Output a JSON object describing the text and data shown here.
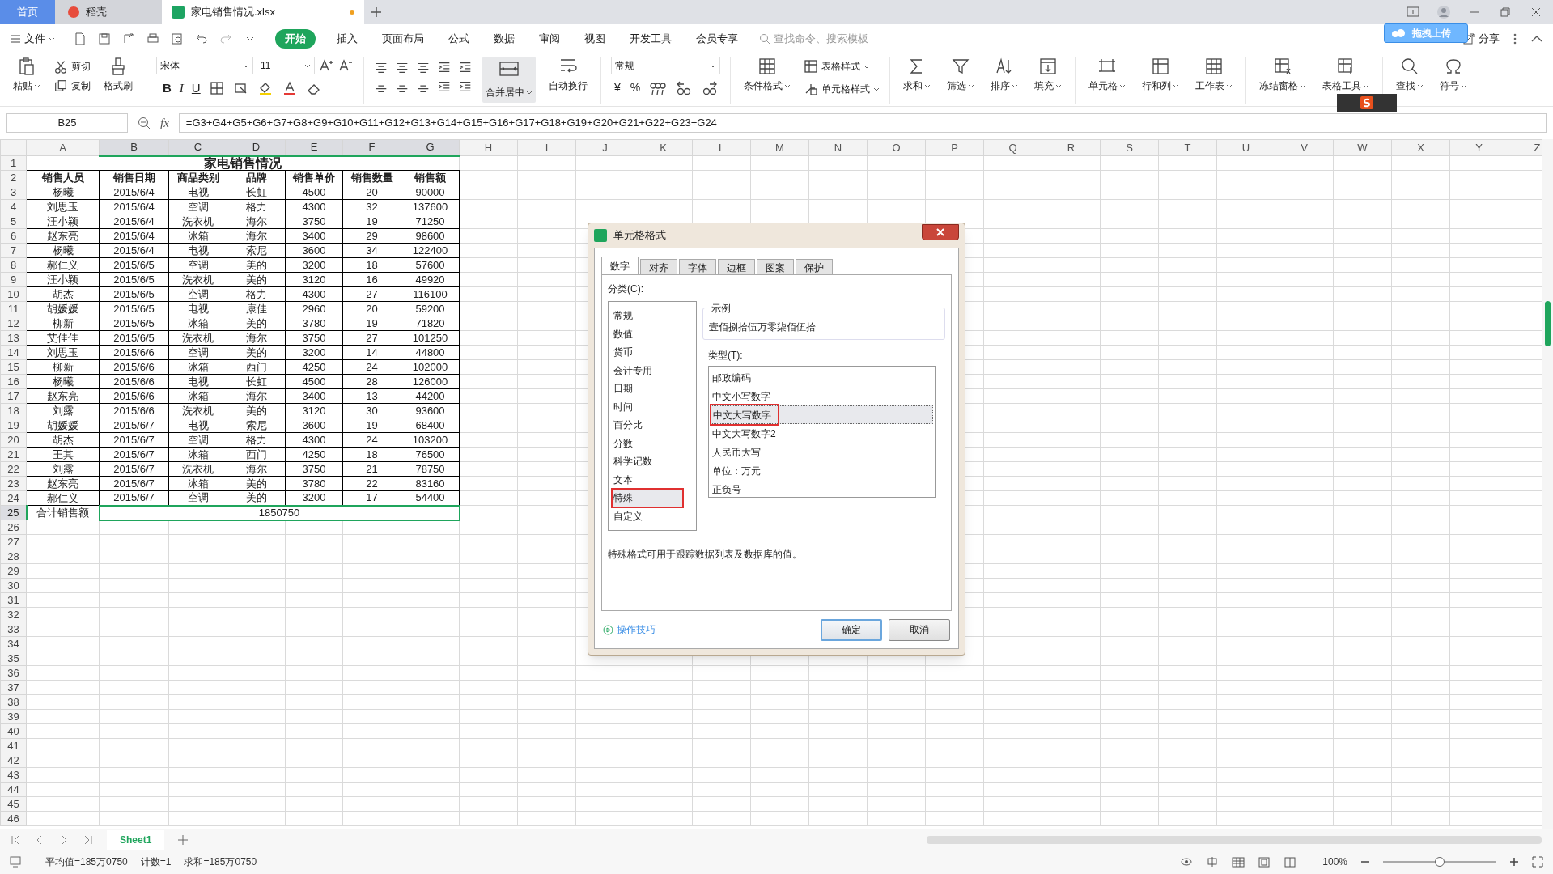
{
  "tabs": [
    {
      "label": "首页",
      "kind": "home",
      "selected": false
    },
    {
      "label": "稻壳",
      "kind": "docer",
      "selected": false
    },
    {
      "label": "家电销售情况.xlsx",
      "kind": "sheet",
      "selected": true,
      "modified": true
    }
  ],
  "menu": {
    "file": "文件",
    "items": [
      {
        "label": "开始",
        "selected": true
      },
      {
        "label": "插入",
        "selected": false
      },
      {
        "label": "页面布局",
        "selected": false
      },
      {
        "label": "公式",
        "selected": false
      },
      {
        "label": "数据",
        "selected": false
      },
      {
        "label": "审阅",
        "selected": false
      },
      {
        "label": "视图",
        "selected": false
      },
      {
        "label": "开发工具",
        "selected": false
      },
      {
        "label": "会员专享",
        "selected": false
      }
    ],
    "search_placeholder": "查找命令、搜索模板",
    "share": "分享",
    "upload_popup": "拖拽上传"
  },
  "clipboard": {
    "paste": "粘贴",
    "cut": "剪切",
    "copy": "复制",
    "format_painter": "格式刷"
  },
  "font": {
    "name": "宋体",
    "size": "11",
    "bold": "B",
    "italic": "I",
    "underline": "U"
  },
  "alignment": {
    "merge": "合并居中",
    "wrap": "自动换行"
  },
  "number": {
    "format": "常规",
    "currency": "¥",
    "percent": "%"
  },
  "styles": {
    "conditional": "条件格式",
    "table_style": "表格样式",
    "cell_style": "单元格样式"
  },
  "tools": [
    {
      "kind": "sum",
      "label": "求和"
    },
    {
      "kind": "filter",
      "label": "筛选"
    },
    {
      "kind": "sort",
      "label": "排序"
    },
    {
      "kind": "fill",
      "label": "填充"
    },
    {
      "kind": "cell",
      "label": "单元格"
    },
    {
      "kind": "rowcol",
      "label": "行和列"
    },
    {
      "kind": "sheet",
      "label": "工作表"
    },
    {
      "kind": "freeze",
      "label": "冻结窗格"
    },
    {
      "kind": "tools",
      "label": "表格工具"
    },
    {
      "kind": "find",
      "label": "查找"
    },
    {
      "kind": "symbol",
      "label": "符号"
    }
  ],
  "formula_bar": {
    "name_box": "B25",
    "fx": "fx",
    "formula": "=G3+G4+G5+G6+G7+G8+G9+G10+G11+G12+G13+G14+G15+G16+G17+G18+G19+G20+G21+G22+G23+G24"
  },
  "columns": [
    {
      "label": "A",
      "selected": false
    },
    {
      "label": "B",
      "selected": true
    },
    {
      "label": "C",
      "selected": true
    },
    {
      "label": "D",
      "selected": true
    },
    {
      "label": "E",
      "selected": true
    },
    {
      "label": "F",
      "selected": true
    },
    {
      "label": "G",
      "selected": true
    },
    {
      "label": "H",
      "selected": false
    },
    {
      "label": "I",
      "selected": false
    },
    {
      "label": "J",
      "selected": false
    },
    {
      "label": "K",
      "selected": false
    },
    {
      "label": "L",
      "selected": false
    },
    {
      "label": "M",
      "selected": false
    },
    {
      "label": "N",
      "selected": false
    },
    {
      "label": "O",
      "selected": false
    },
    {
      "label": "P",
      "selected": false
    },
    {
      "label": "Q",
      "selected": false
    },
    {
      "label": "R",
      "selected": false
    },
    {
      "label": "S",
      "selected": false
    },
    {
      "label": "T",
      "selected": false
    },
    {
      "label": "U",
      "selected": false
    },
    {
      "label": "V",
      "selected": false
    },
    {
      "label": "W",
      "selected": false
    },
    {
      "label": "X",
      "selected": false
    },
    {
      "label": "Y",
      "selected": false
    },
    {
      "label": "Z",
      "selected": false
    }
  ],
  "rows": [
    {
      "label": "1",
      "selected": false
    },
    {
      "label": "2",
      "selected": false
    },
    {
      "label": "3",
      "selected": false
    },
    {
      "label": "4",
      "selected": false
    },
    {
      "label": "5",
      "selected": false
    },
    {
      "label": "6",
      "selected": false
    },
    {
      "label": "7",
      "selected": false
    },
    {
      "label": "8",
      "selected": false
    },
    {
      "label": "9",
      "selected": false
    },
    {
      "label": "10",
      "selected": false
    },
    {
      "label": "11",
      "selected": false
    },
    {
      "label": "12",
      "selected": false
    },
    {
      "label": "13",
      "selected": false
    },
    {
      "label": "14",
      "selected": false
    },
    {
      "label": "15",
      "selected": false
    },
    {
      "label": "16",
      "selected": false
    },
    {
      "label": "17",
      "selected": false
    },
    {
      "label": "18",
      "selected": false
    },
    {
      "label": "19",
      "selected": false
    },
    {
      "label": "20",
      "selected": false
    },
    {
      "label": "21",
      "selected": false
    },
    {
      "label": "22",
      "selected": false
    },
    {
      "label": "23",
      "selected": false
    },
    {
      "label": "24",
      "selected": false
    },
    {
      "label": "25",
      "selected": true
    },
    {
      "label": "26",
      "selected": false
    },
    {
      "label": "27",
      "selected": false
    },
    {
      "label": "28",
      "selected": false
    },
    {
      "label": "29",
      "selected": false
    },
    {
      "label": "30",
      "selected": false
    },
    {
      "label": "31",
      "selected": false
    },
    {
      "label": "32",
      "selected": false
    },
    {
      "label": "33",
      "selected": false
    },
    {
      "label": "34",
      "selected": false
    },
    {
      "label": "35",
      "selected": false
    },
    {
      "label": "36",
      "selected": false
    },
    {
      "label": "37",
      "selected": false
    },
    {
      "label": "38",
      "selected": false
    },
    {
      "label": "39",
      "selected": false
    },
    {
      "label": "40",
      "selected": false
    },
    {
      "label": "41",
      "selected": false
    },
    {
      "label": "42",
      "selected": false
    },
    {
      "label": "43",
      "selected": false
    },
    {
      "label": "44",
      "selected": false
    },
    {
      "label": "45",
      "selected": false
    },
    {
      "label": "46",
      "selected": false
    }
  ],
  "sheet": {
    "title": "家电销售情况",
    "headers": [
      "销售人员",
      "销售日期",
      "商品类别",
      "品牌",
      "销售单价",
      "销售数量",
      "销售额"
    ],
    "data": [
      [
        "杨曦",
        "2015/6/4",
        "电视",
        "长虹",
        "4500",
        "20",
        "90000"
      ],
      [
        "刘思玉",
        "2015/6/4",
        "空调",
        "格力",
        "4300",
        "32",
        "137600"
      ],
      [
        "汪小颖",
        "2015/6/4",
        "洗衣机",
        "海尔",
        "3750",
        "19",
        "71250"
      ],
      [
        "赵东亮",
        "2015/6/4",
        "冰箱",
        "海尔",
        "3400",
        "29",
        "98600"
      ],
      [
        "杨曦",
        "2015/6/4",
        "电视",
        "索尼",
        "3600",
        "34",
        "122400"
      ],
      [
        "郝仁义",
        "2015/6/5",
        "空调",
        "美的",
        "3200",
        "18",
        "57600"
      ],
      [
        "汪小颖",
        "2015/6/5",
        "洗衣机",
        "美的",
        "3120",
        "16",
        "49920"
      ],
      [
        "胡杰",
        "2015/6/5",
        "空调",
        "格力",
        "4300",
        "27",
        "116100"
      ],
      [
        "胡媛媛",
        "2015/6/5",
        "电视",
        "康佳",
        "2960",
        "20",
        "59200"
      ],
      [
        "柳新",
        "2015/6/5",
        "冰箱",
        "美的",
        "3780",
        "19",
        "71820"
      ],
      [
        "艾佳佳",
        "2015/6/5",
        "洗衣机",
        "海尔",
        "3750",
        "27",
        "101250"
      ],
      [
        "刘思玉",
        "2015/6/6",
        "空调",
        "美的",
        "3200",
        "14",
        "44800"
      ],
      [
        "柳新",
        "2015/6/6",
        "冰箱",
        "西门",
        "4250",
        "24",
        "102000"
      ],
      [
        "杨曦",
        "2015/6/6",
        "电视",
        "长虹",
        "4500",
        "28",
        "126000"
      ],
      [
        "赵东亮",
        "2015/6/6",
        "冰箱",
        "海尔",
        "3400",
        "13",
        "44200"
      ],
      [
        "刘露",
        "2015/6/6",
        "洗衣机",
        "美的",
        "3120",
        "30",
        "93600"
      ],
      [
        "胡媛媛",
        "2015/6/7",
        "电视",
        "索尼",
        "3600",
        "19",
        "68400"
      ],
      [
        "胡杰",
        "2015/6/7",
        "空调",
        "格力",
        "4300",
        "24",
        "103200"
      ],
      [
        "王其",
        "2015/6/7",
        "冰箱",
        "西门",
        "4250",
        "18",
        "76500"
      ],
      [
        "刘露",
        "2015/6/7",
        "洗衣机",
        "海尔",
        "3750",
        "21",
        "78750"
      ],
      [
        "赵东亮",
        "2015/6/7",
        "冰箱",
        "美的",
        "3780",
        "22",
        "83160"
      ],
      [
        "郝仁义",
        "2015/6/7",
        "空调",
        "美的",
        "3200",
        "17",
        "54400"
      ]
    ],
    "total_label": "合计销售额",
    "total_value": "1850750"
  },
  "sheet_tabs": [
    {
      "label": "Sheet1",
      "selected": true
    }
  ],
  "status_bar": {
    "average": "平均值=185万0750",
    "count": "计数=1",
    "sum": "求和=185万0750",
    "zoom": "100%",
    "level": 0.5
  },
  "dialog": {
    "title": "单元格格式",
    "tabs": [
      {
        "label": "数字",
        "selected": true
      },
      {
        "label": "对齐",
        "selected": false
      },
      {
        "label": "字体",
        "selected": false
      },
      {
        "label": "边框",
        "selected": false
      },
      {
        "label": "图案",
        "selected": false
      },
      {
        "label": "保护",
        "selected": false
      }
    ],
    "category_label": "分类(C):",
    "categories": [
      {
        "label": "常规",
        "selected": false
      },
      {
        "label": "数值",
        "selected": false
      },
      {
        "label": "货币",
        "selected": false
      },
      {
        "label": "会计专用",
        "selected": false
      },
      {
        "label": "日期",
        "selected": false
      },
      {
        "label": "时间",
        "selected": false
      },
      {
        "label": "百分比",
        "selected": false
      },
      {
        "label": "分数",
        "selected": false
      },
      {
        "label": "科学记数",
        "selected": false
      },
      {
        "label": "文本",
        "selected": false
      },
      {
        "label": "特殊",
        "selected": true
      },
      {
        "label": "自定义",
        "selected": false
      }
    ],
    "sample_label": "示例",
    "sample": "壹佰捌拾伍万零柒佰伍拾",
    "type_label": "类型(T):",
    "types": [
      {
        "label": "邮政编码",
        "selected": false
      },
      {
        "label": "中文小写数字",
        "selected": false
      },
      {
        "label": "中文大写数字",
        "selected": true
      },
      {
        "label": "中文大写数字2",
        "selected": false
      },
      {
        "label": "人民币大写",
        "selected": false
      },
      {
        "label": "单位：万元",
        "selected": false
      },
      {
        "label": "正负号",
        "selected": false
      }
    ],
    "description": "特殊格式可用于跟踪数据列表及数据库的值。",
    "tips": "操作技巧",
    "ok": "确定",
    "cancel": "取消"
  }
}
